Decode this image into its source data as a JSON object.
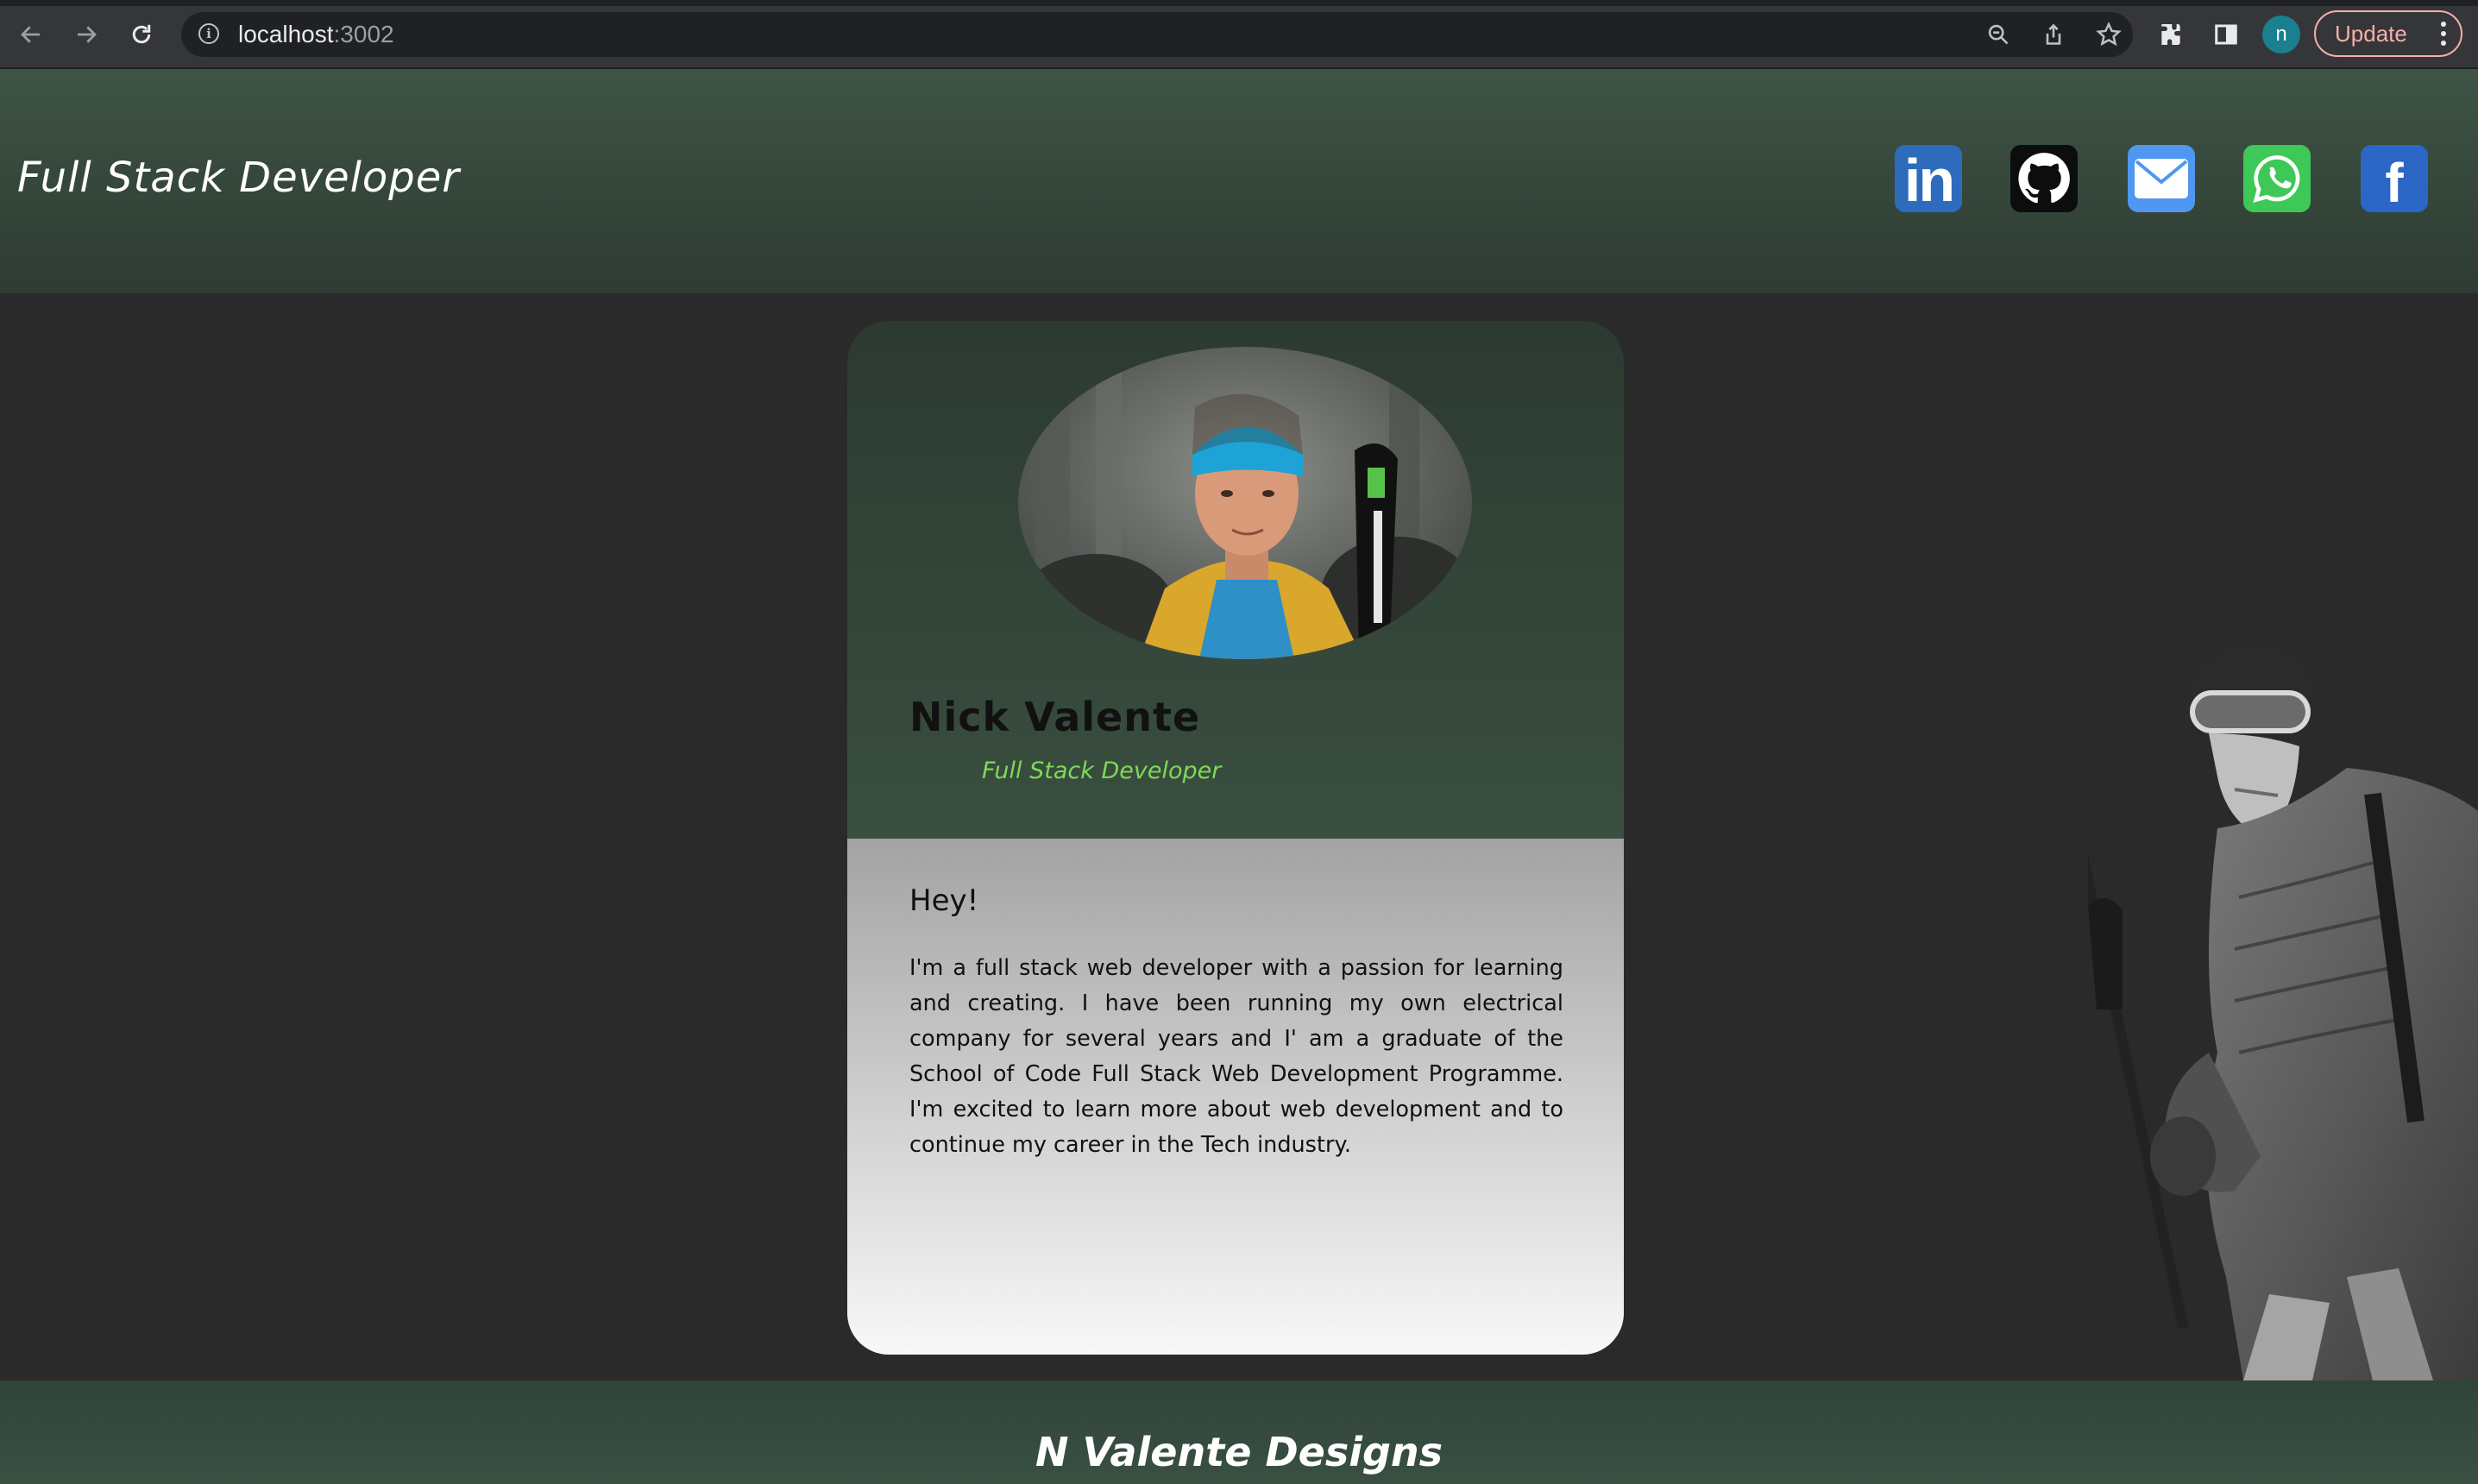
{
  "browser": {
    "url_host": "localhost",
    "url_port": ":3002",
    "profile_initial": "n",
    "update_label": "Update",
    "icons": [
      "back-icon",
      "forward-icon",
      "reload-icon",
      "site-info-icon",
      "zoom-icon",
      "share-icon",
      "bookmark-star-icon",
      "extensions-icon",
      "side-panel-icon",
      "menu-dots-icon"
    ]
  },
  "header": {
    "title": "Full Stack Developer",
    "social_links": [
      {
        "name": "LinkedIn",
        "label": "in",
        "icon": "linkedin-icon",
        "color": "#2d6bbd"
      },
      {
        "name": "GitHub",
        "icon": "github-icon",
        "color": "#0d0d0d"
      },
      {
        "name": "Email",
        "icon": "mail-icon",
        "color": "#4f97f0"
      },
      {
        "name": "WhatsApp",
        "icon": "whatsapp-icon",
        "color": "#3ec857"
      },
      {
        "name": "Facebook",
        "label": "f",
        "icon": "facebook-icon",
        "color": "#2c66c6"
      }
    ]
  },
  "profile": {
    "name": "Nick Valente",
    "role": "Full Stack Developer",
    "greeting": "Hey!",
    "bio": "I'm a full stack web developer with a passion for learning and creating. I have been running my own electrical company for several years and I' am a graduate of the School of Code Full Stack Web Development Programme. I'm excited to learn more about web development and to continue my career in the Tech industry."
  },
  "footer": {
    "brand": "N Valente Designs"
  },
  "colors": {
    "accent_green": "#7ed957",
    "header_bg": "#3e5445",
    "page_bg": "#2a2a2a"
  }
}
